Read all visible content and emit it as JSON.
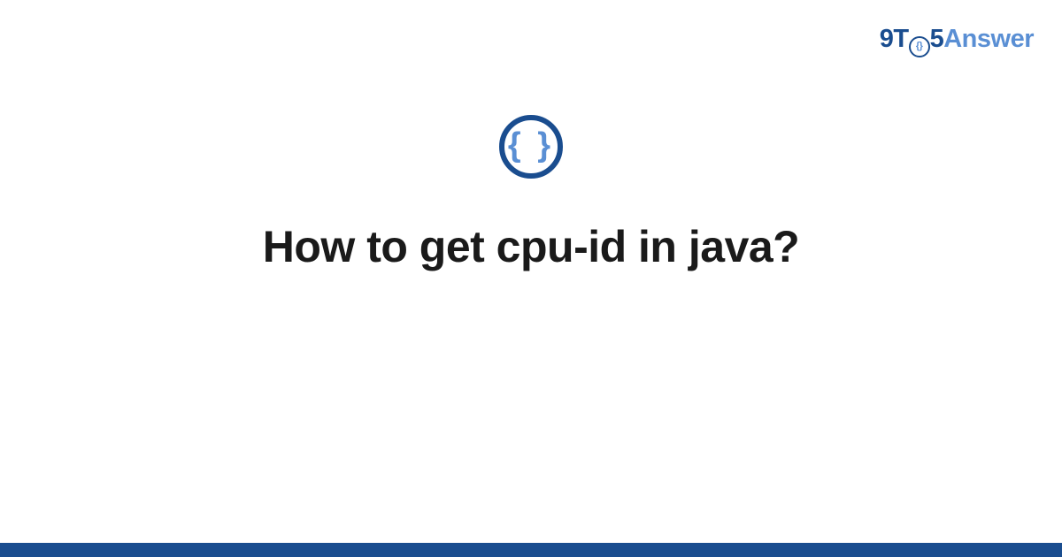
{
  "brand": {
    "part_9t": "9T",
    "part_o_inner": "{}",
    "part_5": "5",
    "part_answer": "Answer"
  },
  "center_icon": {
    "braces": "{ }"
  },
  "title": "How to get cpu-id in java?"
}
